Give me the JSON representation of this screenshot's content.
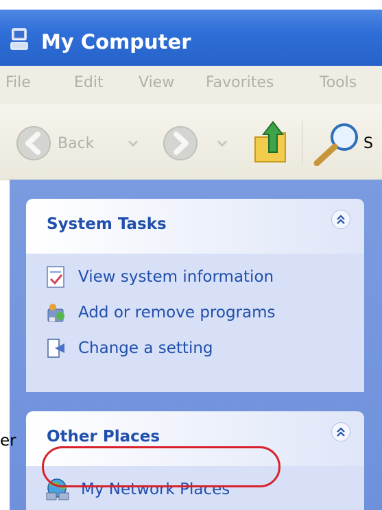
{
  "window": {
    "title": "My Computer"
  },
  "menu": [
    "File",
    "Edit",
    "View",
    "Favorites",
    "Tools"
  ],
  "toolbar": {
    "back_label": "Back",
    "search_label_partial": "S"
  },
  "panels": [
    {
      "title": "System Tasks",
      "items": [
        {
          "label": "View system information",
          "icon": "system-info-icon"
        },
        {
          "label": "Add or remove programs",
          "icon": "add-remove-programs-icon"
        },
        {
          "label": "Change a setting",
          "icon": "control-panel-icon"
        }
      ]
    },
    {
      "title": "Other Places",
      "items": [
        {
          "label": "My Network Places",
          "icon": "network-places-icon",
          "highlighted": true
        }
      ]
    }
  ],
  "left_sliver_text": "er",
  "colors": {
    "title_bar": "#2f6fd8",
    "pane": "#7b9be0",
    "link": "#214fac",
    "highlight_ring": "#d8212b"
  }
}
